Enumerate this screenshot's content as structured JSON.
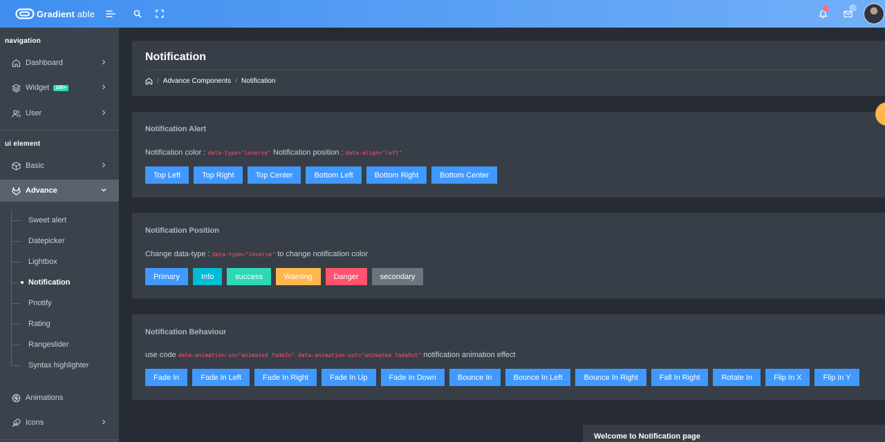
{
  "header": {
    "brand_bold": "Gradient",
    "brand_light": "able",
    "icons": [
      "menu-icon",
      "search-icon",
      "fullscreen-icon",
      "bell-icon",
      "mail-icon"
    ]
  },
  "sidebar": {
    "caption_navigation": "navigation",
    "caption_ui": "ui element",
    "items": [
      {
        "label": "Dashboard",
        "icon": "home-icon"
      },
      {
        "label": "Widget",
        "icon": "layers-icon",
        "badge": "100+"
      },
      {
        "label": "User",
        "icon": "users-icon"
      },
      {
        "label": "Basic",
        "icon": "box-icon"
      },
      {
        "label": "Advance",
        "icon": "gitlab-icon"
      },
      {
        "label": "Animations",
        "icon": "aperture-icon"
      },
      {
        "label": "Icons",
        "icon": "feather-icon"
      }
    ],
    "sub_items": [
      "Sweet alert",
      "Datepicker",
      "Lightbox",
      "Notification",
      "Pnotify",
      "Rating",
      "Rangeslider",
      "Syntax highlighter"
    ]
  },
  "page": {
    "title": "Notification",
    "breadcrumb": [
      "Advance Components",
      "Notification"
    ]
  },
  "alert_card": {
    "title": "Notification Alert",
    "text1": "Notification color : ",
    "code1": "data-type=\"inverse\"",
    "text2": " Notification position : ",
    "code2": "data-align=\"left\"",
    "buttons": [
      "Top Left",
      "Top Right",
      "Top Center",
      "Bottom Left",
      "Bottom Right",
      "Bottom Center"
    ]
  },
  "position_card": {
    "title": "Notification Position",
    "text1": "Change data-type : ",
    "code1": "data-type=\"inverse\"",
    "text2": " to change notification color",
    "buttons": [
      "Primary",
      "Info",
      "success",
      "Warning",
      "Danger",
      "secondary"
    ]
  },
  "behaviour_card": {
    "title": "Notification Behaviour",
    "text1": "use code ",
    "code1": "data-animation-in=\"animated fadeIn\" data-animation-out=\"animated fadeOut\"",
    "text2": " notification animation effect",
    "buttons": [
      "Fade In",
      "Fade In Left",
      "Fade In Right",
      "Fade In Up",
      "Fade In Down",
      "Bounce In",
      "Bounce In Left",
      "Bounce In Right",
      "Fall In Right",
      "Rotate In",
      "Flip In X",
      "Flip In Y"
    ]
  },
  "toast": {
    "text": "Welcome to Notification page"
  },
  "colors": {
    "primary": "#4099ff",
    "info": "#00bcd4",
    "success": "#2ed8b6",
    "warning": "#ffb64d",
    "danger": "#ff5370",
    "secondary": "#6c757d",
    "code": "#ff5370"
  }
}
